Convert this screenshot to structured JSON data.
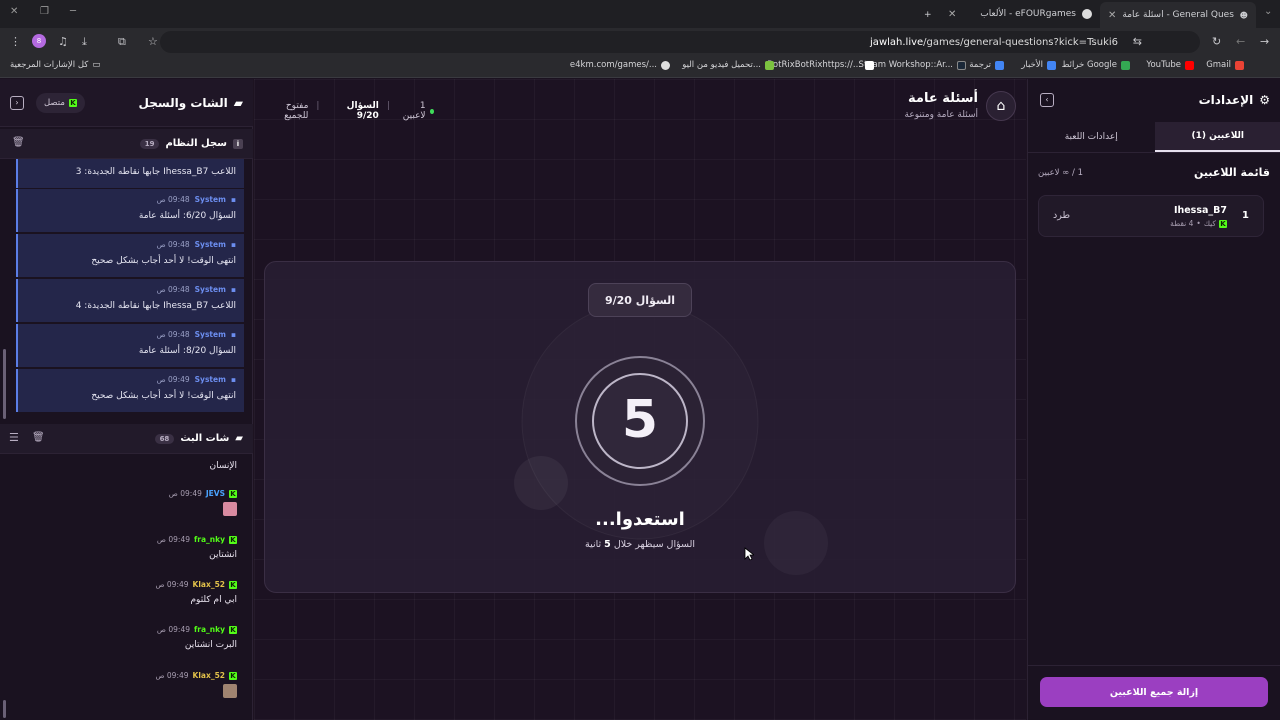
{
  "browser": {
    "tabs": [
      {
        "label": "أسئلة عامة - General Questions",
        "active": true
      },
      {
        "label": "الألعاب - eFOURgames",
        "active": false
      }
    ],
    "url_host": "jawlah.live",
    "url_path": "/games/general-questions?kick=Tsuki6",
    "bookmarks": [
      {
        "label": "Gmail",
        "color": "#ea4335"
      },
      {
        "label": "YouTube",
        "color": "#ff0000"
      },
      {
        "label": "خرائط Google",
        "color": "#34a853"
      },
      {
        "label": "الأخبار",
        "color": "#4285f4"
      },
      {
        "label": "ترجمة",
        "color": "#4285f4"
      },
      {
        "label": "Steam Workshop::Ar...",
        "color": "#1b2838"
      },
      {
        "label": "BotRixBotRixhttps://...",
        "color": "#ffffff"
      },
      {
        "label": "تحميل فيديو من اليو...",
        "color": "#7cc340"
      },
      {
        "label": "e4km.com/games/...",
        "color": "#dddddd"
      }
    ],
    "all_bookmarks": "كل الإشارات المرجعية"
  },
  "settings_panel": {
    "title": "الإعدادات",
    "tabs": [
      "اللاعبين (1)",
      "إعدادات اللعبة"
    ],
    "player_list_title": "قائمة اللاعبين",
    "player_count": "1 / ∞ لاعبين",
    "players": [
      {
        "rank": "1",
        "name": "Ihessa_B7",
        "platform": "كيك",
        "points": "4 نقطة",
        "kick_label": "طرد"
      }
    ],
    "remove_all": "إزالة جميع اللاعبين"
  },
  "header": {
    "game_title": "أسئلة عامة",
    "game_subtitle": "أسئلة عامة ومتنوعة",
    "players_status": "1 لاعبين",
    "question_status": "السؤال 9/20",
    "open_status": "مفتوح للجميع"
  },
  "center": {
    "question_badge": "السؤال 9/20",
    "countdown": "5",
    "ready_text": "استعدوا...",
    "subtext_before": "السؤال سيظهر خلال",
    "subtext_num": "5",
    "subtext_after": "ثانية"
  },
  "chat_panel": {
    "title": "الشات والسجل",
    "status": "متصل",
    "system_log_title": "سجل النظام",
    "system_log_count": "19",
    "log_messages": [
      {
        "sender": "",
        "time": "",
        "text": "اللاعب Ihessa_B7 جابها نقاطه الجديدة: 3"
      },
      {
        "sender": "System",
        "time": "09:48 ص",
        "text": "السؤال 6/20: أسئلة عامة"
      },
      {
        "sender": "System",
        "time": "09:48 ص",
        "text": "انتهى الوقت! لا أحد أجاب بشكل صحيح"
      },
      {
        "sender": "System",
        "time": "09:48 ص",
        "text": "اللاعب Ihessa_B7 جابها نقاطه الجديدة: 4"
      },
      {
        "sender": "System",
        "time": "09:48 ص",
        "text": "السؤال 8/20: أسئلة عامة"
      },
      {
        "sender": "System",
        "time": "09:49 ص",
        "text": "انتهى الوقت! لا أحد أجاب بشكل صحيح"
      }
    ],
    "stream_chat_title": "شات البث",
    "stream_chat_count": "68",
    "chat_messages": [
      {
        "user": "",
        "time": "",
        "text": "الإنسان",
        "color": "#e8e2ee"
      },
      {
        "user": "JEVS",
        "time": "09:49 ص",
        "text": "",
        "color": "#4aa3ff"
      },
      {
        "user": "fra_nky",
        "time": "09:49 ص",
        "text": "انشتاين",
        "color": "#53fc18"
      },
      {
        "user": "Klax_52",
        "time": "09:49 ص",
        "text": "ابي ام كلثوم",
        "color": "#e2c14a"
      },
      {
        "user": "fra_nky",
        "time": "09:49 ص",
        "text": "البرت انشتاين",
        "color": "#53fc18"
      },
      {
        "user": "Klax_52",
        "time": "09:49 ص",
        "text": "",
        "color": "#e2c14a"
      }
    ]
  }
}
